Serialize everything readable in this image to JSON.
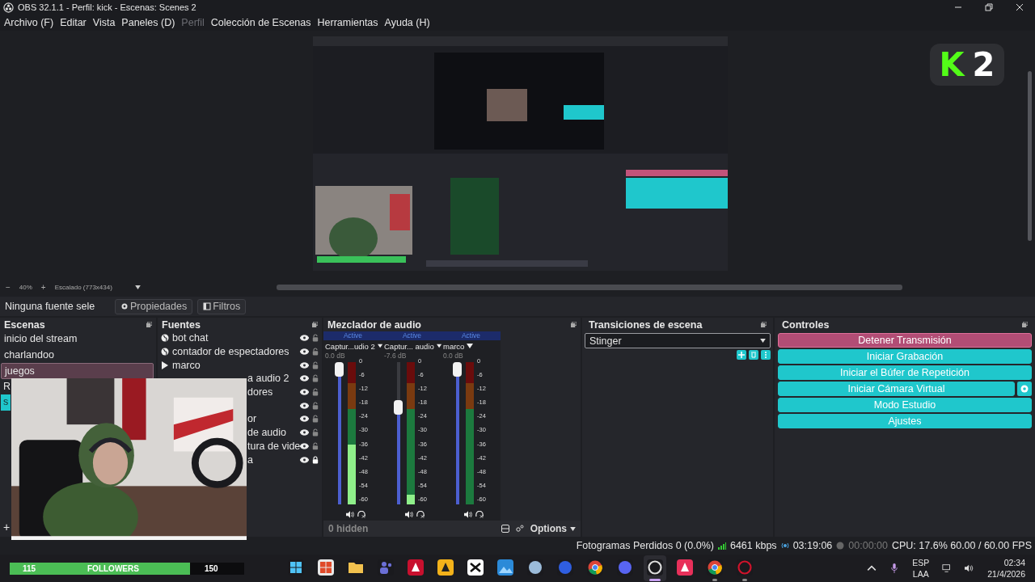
{
  "window": {
    "title": "OBS 32.1.1 - Perfil: kick - Escenas: Scenes 2"
  },
  "menu": [
    {
      "label": "Archivo (F)",
      "disabled": false
    },
    {
      "label": "Editar",
      "disabled": false
    },
    {
      "label": "Vista",
      "disabled": false
    },
    {
      "label": "Paneles (D)",
      "disabled": false
    },
    {
      "label": "Perfil",
      "disabled": true
    },
    {
      "label": "Colección de Escenas",
      "disabled": false
    },
    {
      "label": "Herramientas",
      "disabled": false
    },
    {
      "label": "Ayuda (H)",
      "disabled": false
    }
  ],
  "preview": {
    "logo": {
      "letter": "K",
      "number": "2"
    }
  },
  "preview_toolbar": {
    "zoom_out": "−",
    "zoom": "40%",
    "zoom_in": "+",
    "scale": "Escalado (773x434)"
  },
  "source_toolbar": {
    "status": "Ninguna fuente sele",
    "properties": "Propiedades",
    "filters": "Filtros"
  },
  "scenes": {
    "title": "Escenas",
    "add": "+",
    "items": [
      {
        "name": "inicio del stream",
        "selected": false,
        "hovered": false,
        "covered": false
      },
      {
        "name": "charlandoo",
        "selected": false,
        "hovered": false,
        "covered": false
      },
      {
        "name": "juegos",
        "selected": false,
        "hovered": true,
        "covered": false
      },
      {
        "name": "R",
        "selected": false,
        "hovered": false,
        "covered": true
      },
      {
        "name": "s",
        "selected": true,
        "hovered": false,
        "covered": true
      }
    ]
  },
  "sources": {
    "title": "Fuentes",
    "items": [
      {
        "name": "bot chat",
        "kind": "browser",
        "covered": false,
        "visible": true,
        "locked": false
      },
      {
        "name": "contador de espectadores",
        "kind": "browser",
        "covered": false,
        "visible": true,
        "locked": false
      },
      {
        "name": "marco",
        "kind": "media",
        "covered": false,
        "visible": true,
        "locked": false
      },
      {
        "name": "a audio 2",
        "kind": "none",
        "covered": true,
        "visible": true,
        "locked": false
      },
      {
        "name": "dores",
        "kind": "none",
        "covered": true,
        "visible": true,
        "locked": false
      },
      {
        "kind": "none",
        "visible": true,
        "locked": false
      },
      {
        "name": "or",
        "kind": "none",
        "covered": true,
        "visible": true,
        "locked": false
      },
      {
        "name": "de audio",
        "kind": "none",
        "covered": true,
        "visible": true,
        "locked": false
      },
      {
        "name": "tura de vide",
        "kind": "none",
        "covered": true,
        "visible": true,
        "locked": false
      },
      {
        "name": "a",
        "kind": "none",
        "covered": true,
        "visible": true,
        "locked": true
      }
    ]
  },
  "mixer": {
    "title": "Mezclador de audio",
    "channels": [
      {
        "status": "Active",
        "name": "Captur...udio 2",
        "reading": "0.0 dB",
        "fader": {
          "level": 1
        },
        "meter": {
          "level": 0.42
        },
        "scale": [
          "0",
          "-6",
          "-12",
          "-18",
          "-24",
          "-30",
          "-36",
          "-42",
          "-48",
          "-54",
          "-60"
        ]
      },
      {
        "status": "Active",
        "name": "Captur... audio",
        "reading": "-7.6 dB",
        "fader": {
          "level": 0.7
        },
        "meter": {
          "level": 0.07
        },
        "scale": [
          "0",
          "-6",
          "-12",
          "-18",
          "-24",
          "-30",
          "-36",
          "-42",
          "-48",
          "-54",
          "-60"
        ]
      },
      {
        "status": "Active",
        "name": "marco",
        "reading": "0.0 dB",
        "fader": {
          "level": 1
        },
        "scale": [
          "0",
          "-6",
          "-12",
          "-18",
          "-24",
          "-30",
          "-36",
          "-42",
          "-48",
          "-54",
          "-60"
        ]
      }
    ],
    "hidden": "0 hidden",
    "options": "Options"
  },
  "transitions": {
    "title": "Transiciones de escena",
    "selected": "Stinger"
  },
  "controls": {
    "title": "Controles",
    "buttons": [
      {
        "label": "Detener Transmisión",
        "active": true,
        "settings": false
      },
      {
        "label": "Iniciar Grabación",
        "active": false,
        "settings": false
      },
      {
        "label": "Iniciar el Búfer de Repetición",
        "active": false,
        "settings": false
      },
      {
        "label": "Iniciar Cámara Virtual",
        "active": false,
        "settings": true
      },
      {
        "label": "Modo Estudio",
        "active": false,
        "settings": false
      },
      {
        "label": "Ajustes",
        "active": false,
        "settings": false
      }
    ]
  },
  "status_bar": {
    "dropped": "Fotogramas Perdidos 0 (0.0%)",
    "bitrate": "6461 kbps",
    "stream_time": "03:19:06",
    "record_time": "00:00:00",
    "cpu": "CPU: 17.6% 60.00 / 60.00 FPS"
  },
  "followers": {
    "current": "115",
    "label": "FOLLOWERS",
    "goal": "150",
    "level": 0.77
  },
  "taskbar": {
    "apps": [
      {
        "kind": "start",
        "open": false,
        "focused": false
      },
      {
        "kind": "store",
        "open": false,
        "focused": false
      },
      {
        "kind": "folder",
        "open": false,
        "focused": false
      },
      {
        "kind": "people",
        "open": false,
        "focused": false
      },
      {
        "kind": "redtile",
        "open": false,
        "focused": false
      },
      {
        "kind": "yellowtile",
        "open": false,
        "focused": false
      },
      {
        "kind": "whitetile",
        "open": false,
        "focused": false
      },
      {
        "kind": "photos",
        "open": false,
        "focused": false
      },
      {
        "kind": "steam",
        "open": false,
        "focused": false
      },
      {
        "kind": "bluecircle",
        "open": false,
        "focused": false
      },
      {
        "kind": "browser",
        "open": false,
        "focused": false
      },
      {
        "kind": "chat",
        "open": false,
        "focused": false
      },
      {
        "kind": "obs",
        "open": true,
        "focused": true
      },
      {
        "kind": "note",
        "open": false,
        "focused": false
      },
      {
        "kind": "browser",
        "open": true,
        "focused": false
      },
      {
        "kind": "ring",
        "open": true,
        "focused": false
      }
    ],
    "language": "ESP",
    "layout": "LAA",
    "time": "02:34",
    "date": "21/4/2026"
  }
}
